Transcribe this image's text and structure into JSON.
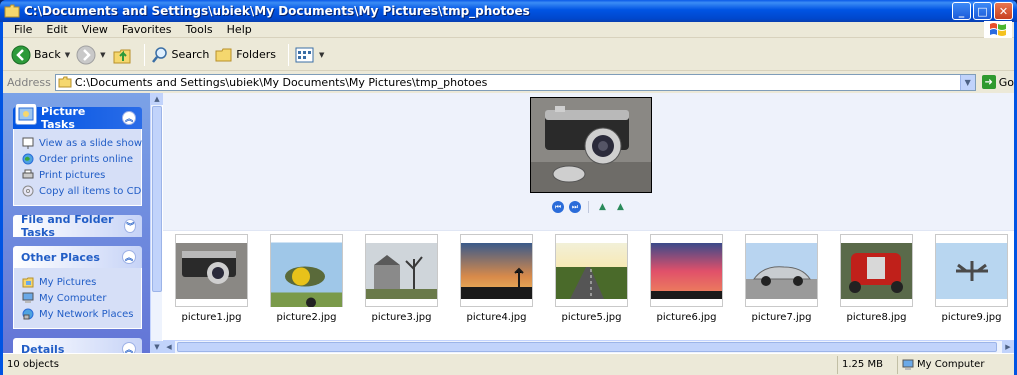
{
  "window": {
    "title": "C:\\Documents and Settings\\ubiek\\My Documents\\My Pictures\\tmp_photoes",
    "controls": [
      "minimize",
      "maximize",
      "close"
    ]
  },
  "menu": [
    "File",
    "Edit",
    "View",
    "Favorites",
    "Tools",
    "Help"
  ],
  "toolbar": {
    "back_label": "Back",
    "search_label": "Search",
    "folders_label": "Folders"
  },
  "address": {
    "label": "Address",
    "value": "C:\\Documents and Settings\\ubiek\\My Documents\\My Pictures\\tmp_photoes",
    "go_label": "Go"
  },
  "taskpane": {
    "picture_tasks": {
      "title": "Picture Tasks",
      "items": [
        "View as a slide show",
        "Order prints online",
        "Print pictures",
        "Copy all items to CD"
      ]
    },
    "file_folder_tasks": {
      "title": "File and Folder Tasks"
    },
    "other_places": {
      "title": "Other Places",
      "items": [
        "My Pictures",
        "My Computer",
        "My Network Places"
      ]
    },
    "details": {
      "title": "Details"
    }
  },
  "files": [
    "picture1.jpg",
    "picture2.jpg",
    "picture3.jpg",
    "picture4.jpg",
    "picture5.jpg",
    "picture6.jpg",
    "picture7.jpg",
    "picture8.jpg",
    "picture9.jpg"
  ],
  "status": {
    "objects": "10 objects",
    "size": "1.25 MB",
    "location": "My Computer"
  },
  "colors": {
    "titlebar": "#0054e3",
    "taskpane": "#6f8fe0",
    "link": "#215dc6"
  }
}
